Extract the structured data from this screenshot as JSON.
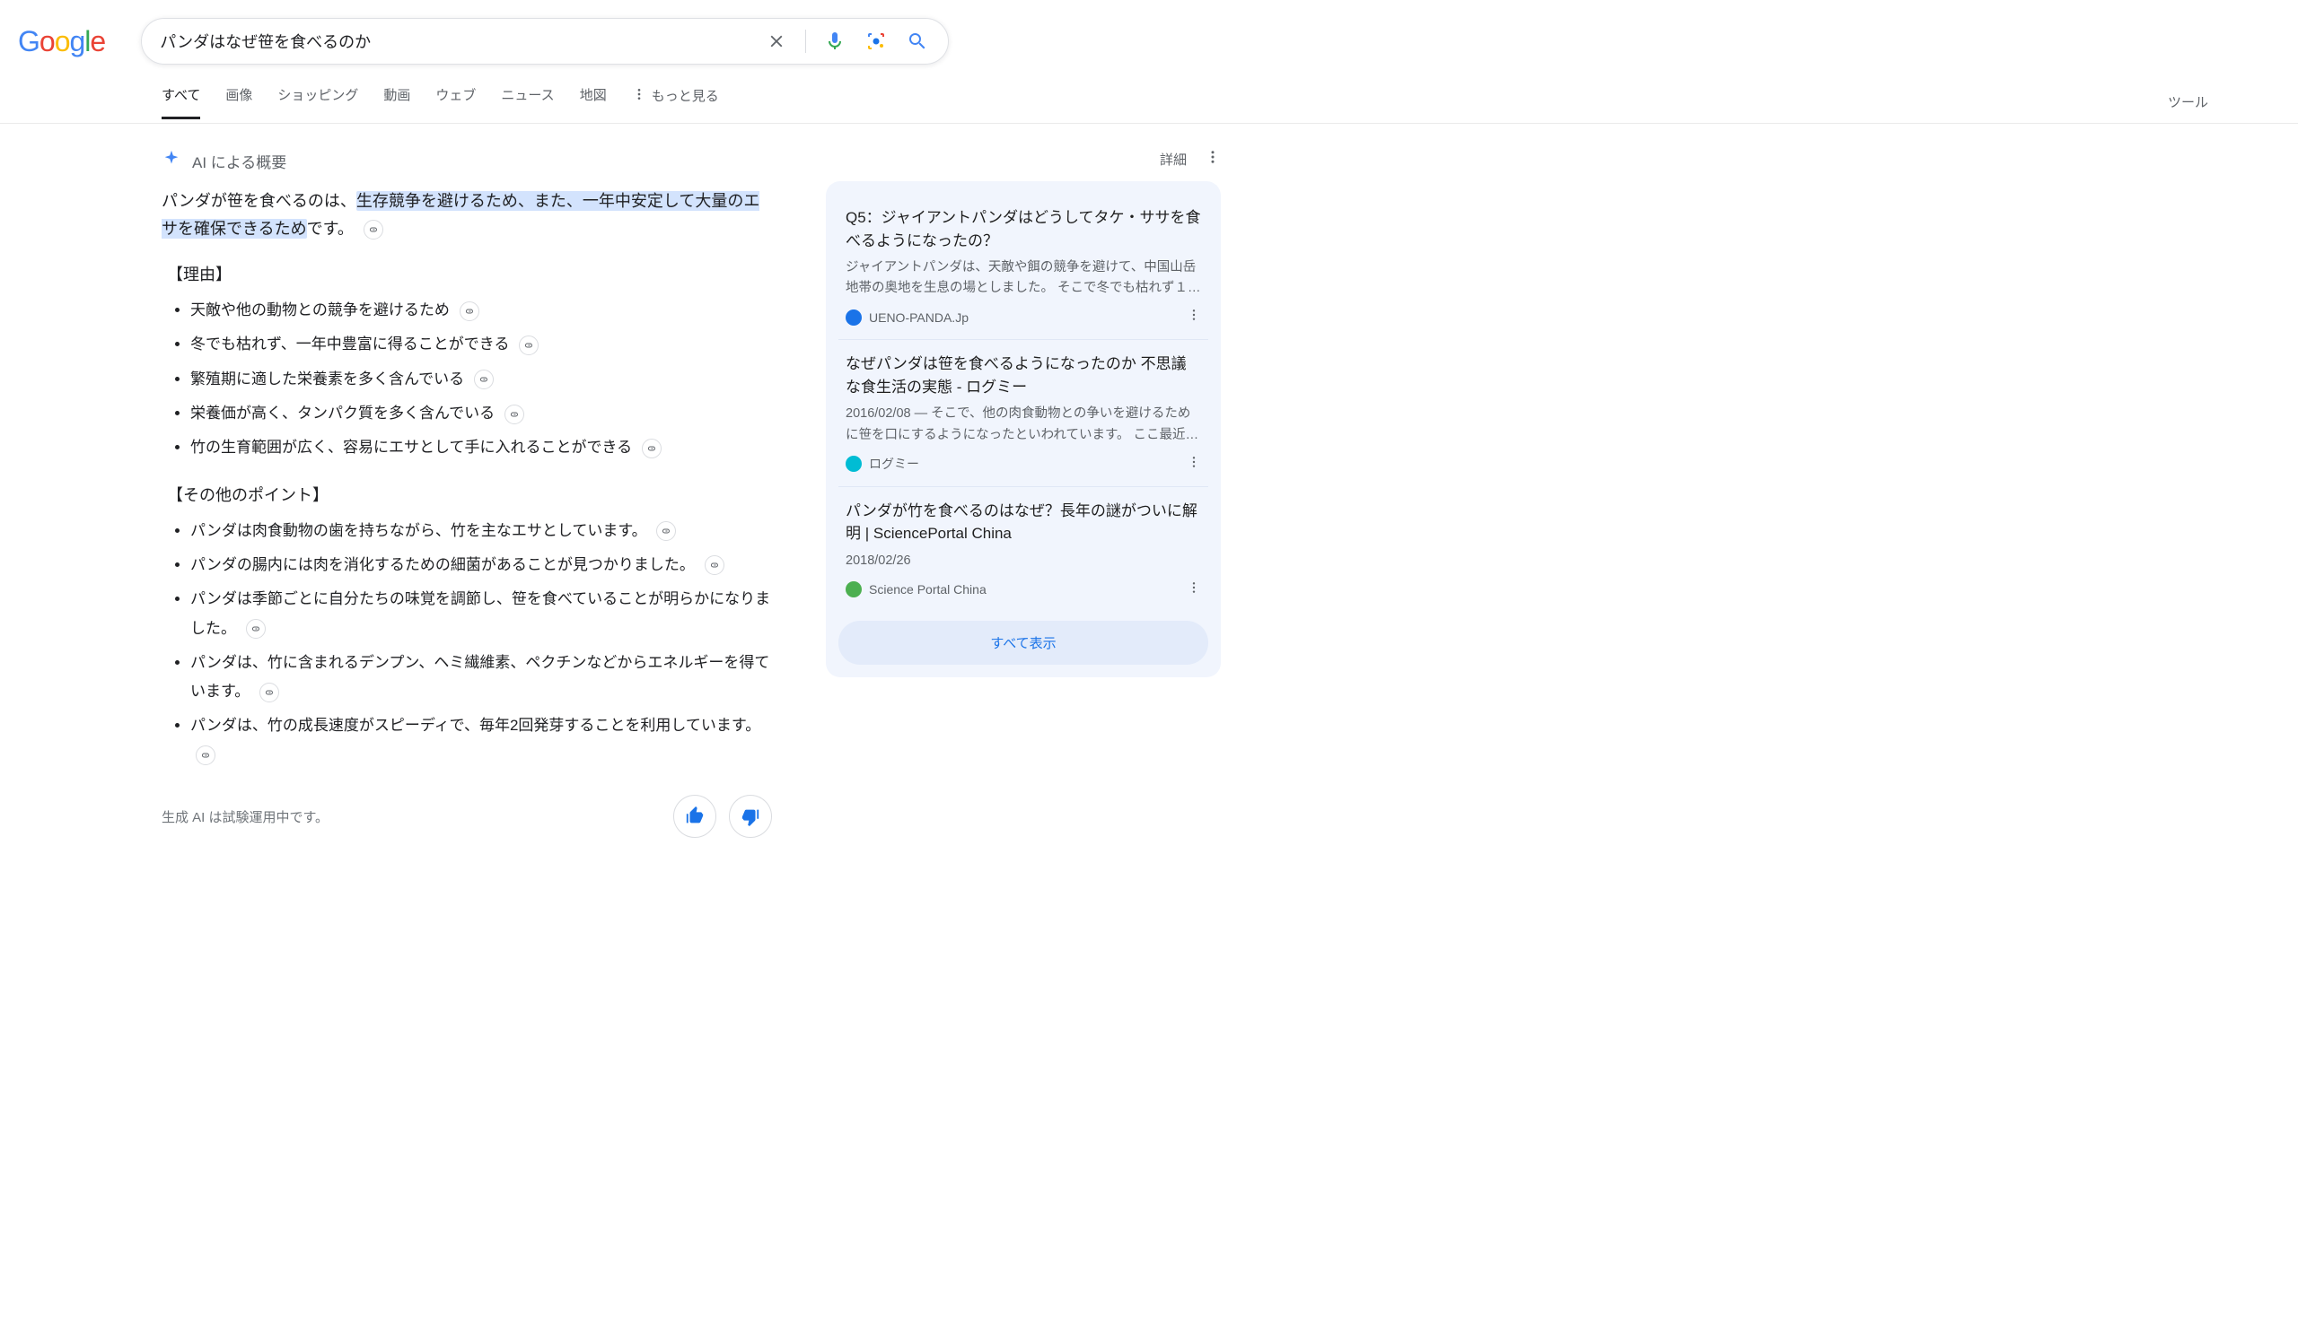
{
  "search": {
    "query": "パンダはなぜ笹を食べるのか"
  },
  "tabs": {
    "all": "すべて",
    "images": "画像",
    "shopping": "ショッピング",
    "videos": "動画",
    "web": "ウェブ",
    "news": "ニュース",
    "maps": "地図",
    "more": "もっと見る",
    "tools": "ツール"
  },
  "ai": {
    "title": "AI による概要",
    "details": "詳細",
    "summary_prefix": "パンダが笹を食べるのは、",
    "summary_highlight": "生存競争を避けるため、また、一年中安定して大量のエサを確保できるため",
    "summary_suffix": "です。",
    "section_reasons": "【理由】",
    "reasons": [
      "天敵や他の動物との競争を避けるため",
      "冬でも枯れず、一年中豊富に得ることができる",
      "繁殖期に適した栄養素を多く含んでいる",
      "栄養価が高く、タンパク質を多く含んでいる",
      "竹の生育範囲が広く、容易にエサとして手に入れることができる"
    ],
    "section_other": "【その他のポイント】",
    "others": [
      "パンダは肉食動物の歯を持ちながら、竹を主なエサとしています。",
      "パンダの腸内には肉を消化するための細菌があることが見つかりました。",
      "パンダは季節ごとに自分たちの味覚を調節し、笹を食べていることが明らかになりました。",
      "パンダは、竹に含まれるデンプン、ヘミ繊維素、ペクチンなどからエネルギーを得ています。",
      "パンダは、竹の成長速度がスピーディで、毎年2回発芽することを利用しています。"
    ],
    "disclaimer": "生成 AI は試験運用中です。"
  },
  "refs": {
    "items": [
      {
        "title": "Q5：ジャイアントパンダはどうしてタケ・ササを食べるようになったの？",
        "snippet": "ジャイアントパンダは、天敵や餌の競争を避けて、中国山岳地帯の奥地を生息の場としました。 そこで冬でも枯れず１年を…",
        "source": "UENO-PANDA.Jp",
        "fav": "#1a73e8"
      },
      {
        "title": "なぜパンダは笹を食べるようになったのか 不思議な食生活の実態 - ログミー",
        "snippet": "2016/02/08 — そこで、他の肉食動物との争いを避けるために笹を口にするようになったといわれています。 ここ最近にな…",
        "source": "ログミー",
        "fav": "#00bcd4"
      },
      {
        "title": "パンダが竹を食べるのはなぜ？長年の謎がついに解明 | SciencePortal China",
        "snippet": "2018/02/26",
        "source": "Science Portal China",
        "fav": "#4caf50"
      }
    ],
    "show_all": "すべて表示"
  }
}
